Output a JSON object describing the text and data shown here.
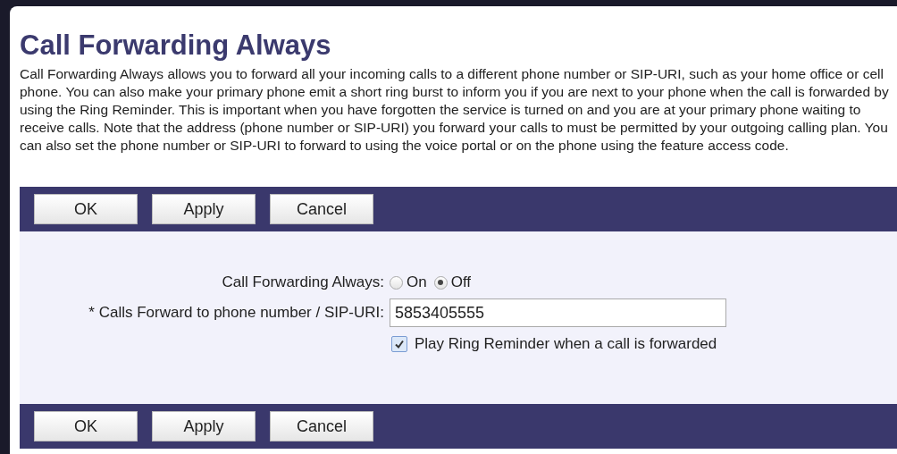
{
  "title": "Call Forwarding Always",
  "description": "Call Forwarding Always allows you to forward all your incoming calls to a different phone number or SIP-URI, such as your home office or cell phone. You can also make your primary phone emit a short ring burst to inform you if you are next to your phone when the call is forwarded by using the Ring Reminder. This is important when you have forgotten the service is turned on and you are at your primary phone waiting to receive calls. Note that the address (phone number or SIP-URI) you forward your calls to must be permitted by your outgoing calling plan. You can also set the phone number or SIP-URI to forward to using the voice portal or on the phone using the feature access code.",
  "top_buttons": [
    "OK",
    "Apply",
    "Cancel"
  ],
  "form": {
    "status": {
      "label": "Call Forwarding Always:",
      "options": [
        {
          "label": "On",
          "selected": false
        },
        {
          "label": "Off",
          "selected": true
        }
      ]
    },
    "forward_to": {
      "label": "* Calls Forward to phone number / SIP-URI:",
      "value": "5853405555"
    },
    "ring_reminder": {
      "label": "Play Ring Reminder when a call is forwarded",
      "checked": true
    }
  },
  "bottom_buttons": [
    "OK",
    "Apply",
    "Cancel"
  ]
}
